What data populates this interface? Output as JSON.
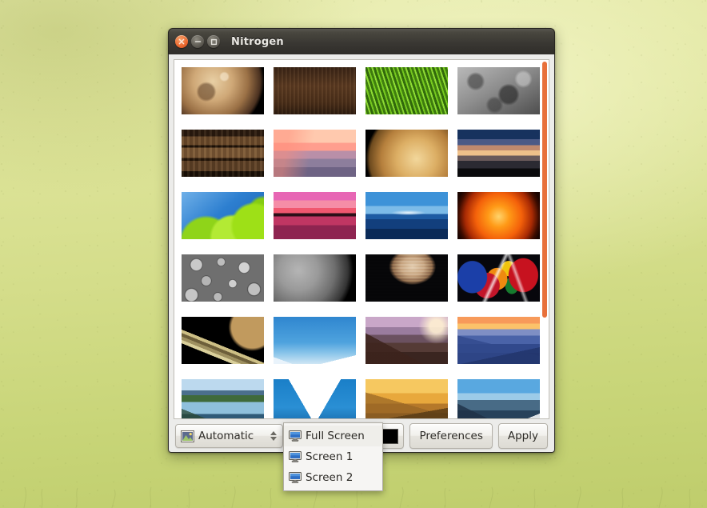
{
  "desktop": {
    "background_top": "#e4e9a7",
    "background_bottom": "#bfcd6c"
  },
  "window": {
    "title": "Nitrogen",
    "controls": {
      "close_label": "Close",
      "close_icon": "close-icon",
      "close_color": "#ec6a30",
      "minimize_label": "Minimize",
      "minimize_icon": "minimize-icon",
      "maximize_label": "Maximize",
      "maximize_icon": "maximize-icon"
    }
  },
  "wallpaper_list": {
    "scrollbar_color": "#e8703a",
    "items": [
      {
        "name": "mars-planet",
        "alt": "Mars planet on black"
      },
      {
        "name": "dark-wood-texture",
        "alt": "Dark brown wood texture"
      },
      {
        "name": "green-grass",
        "alt": "Close-up green grass blades"
      },
      {
        "name": "moon-surface",
        "alt": "Grey cratered moon surface"
      },
      {
        "name": "wood-planks",
        "alt": "Weathered wooden planks"
      },
      {
        "name": "pink-sunset-sea",
        "alt": "Pink and purple sunset over sea"
      },
      {
        "name": "venus-planet",
        "alt": "Golden Venus planet on black"
      },
      {
        "name": "beach-dusk",
        "alt": "Blue and orange dusk over beach"
      },
      {
        "name": "green-leaves-sky",
        "alt": "Green leaves against blue sky"
      },
      {
        "name": "magenta-sunset",
        "alt": "Magenta sunset over water"
      },
      {
        "name": "blue-ocean",
        "alt": "Blue ocean and clouds"
      },
      {
        "name": "orange-sun",
        "alt": "Orange sun sphere"
      },
      {
        "name": "grey-pebbles",
        "alt": "Grey pebble stones"
      },
      {
        "name": "grey-moon-crescent",
        "alt": "Grey moon crescent on black"
      },
      {
        "name": "jupiter-planet",
        "alt": "Jupiter planet on black"
      },
      {
        "name": "clownfish-art",
        "alt": "Colorful stylized clownfish artwork"
      },
      {
        "name": "saturn-rings",
        "alt": "Saturn with rings"
      },
      {
        "name": "snow-peaks-blue-sky",
        "alt": "Snowy peaks under blue sky"
      },
      {
        "name": "mountain-road-sunrise",
        "alt": "Winding mountain road at sunrise"
      },
      {
        "name": "blue-mountain-layers",
        "alt": "Layered blue mountains at sunset"
      },
      {
        "name": "alpine-lake",
        "alt": "Alpine lake with snowy mountains"
      },
      {
        "name": "snow-mountain-peak",
        "alt": "Single snow covered peak"
      },
      {
        "name": "golden-hills",
        "alt": "Golden rolling hills at sunset"
      },
      {
        "name": "rocky-mountain-range",
        "alt": "Rocky snow covered mountain range"
      }
    ]
  },
  "toolbar": {
    "mode_combo": {
      "value": "Automatic",
      "icon": "image-icon"
    },
    "color_button": {
      "label": "Background color",
      "color": "#000000",
      "icon": "color-swatch-icon"
    },
    "preferences_label": "Preferences",
    "apply_label": "Apply"
  },
  "screen_menu": {
    "items": [
      {
        "label": "Full Screen",
        "icon": "monitor-icon",
        "highlighted": true
      },
      {
        "label": "Screen 1",
        "icon": "monitor-icon",
        "highlighted": false
      },
      {
        "label": "Screen 2",
        "icon": "monitor-icon",
        "highlighted": false
      }
    ]
  }
}
